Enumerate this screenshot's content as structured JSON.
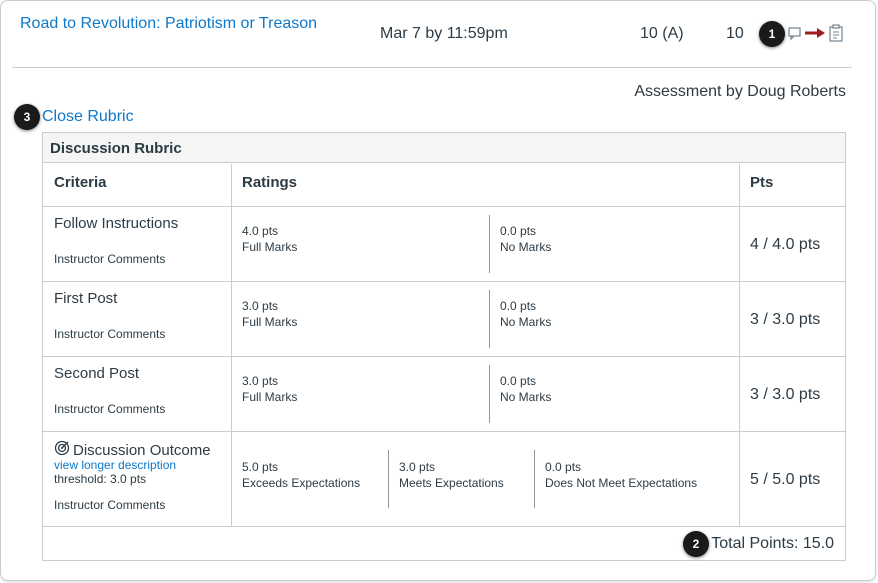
{
  "assignment": {
    "title": "Road to Revolution: Patriotism or Treason",
    "due": "Mar 7 by 11:59pm",
    "score": "10 (A)",
    "out_of": "10"
  },
  "assessor": "Assessment by Doug Roberts",
  "close_rubric": "Close Rubric",
  "callouts": [
    "1",
    "2",
    "3"
  ],
  "icons": [
    "comment-icon",
    "arrow-pointer-icon",
    "rubric-clipboard-icon"
  ],
  "rubric": {
    "title": "Discussion Rubric",
    "headers": {
      "criteria": "Criteria",
      "ratings": "Ratings",
      "pts": "Pts"
    },
    "rows": [
      {
        "name": "Follow Instructions",
        "comments": "Instructor Comments",
        "ratings": [
          {
            "pts": "4.0 pts",
            "label": "Full Marks"
          },
          {
            "pts": "0.0 pts",
            "label": "No Marks"
          }
        ],
        "score": "4 / 4.0 pts"
      },
      {
        "name": "First Post",
        "comments": "Instructor Comments",
        "ratings": [
          {
            "pts": "3.0 pts",
            "label": "Full Marks"
          },
          {
            "pts": "0.0 pts",
            "label": "No Marks"
          }
        ],
        "score": "3 / 3.0 pts"
      },
      {
        "name": "Second Post",
        "comments": "Instructor Comments",
        "ratings": [
          {
            "pts": "3.0 pts",
            "label": "Full Marks"
          },
          {
            "pts": "0.0 pts",
            "label": "No Marks"
          }
        ],
        "score": "3 / 3.0 pts"
      },
      {
        "name": "Discussion Outcome",
        "icon": "outcome-target-icon",
        "link": "view longer description",
        "threshold": "threshold: 3.0 pts",
        "comments": "Instructor Comments",
        "ratings": [
          {
            "pts": "5.0 pts",
            "label": "Exceeds Expectations"
          },
          {
            "pts": "3.0 pts",
            "label": "Meets Expectations"
          },
          {
            "pts": "0.0 pts",
            "label": "Does Not Meet Expectations"
          }
        ],
        "score": "5 / 5.0 pts"
      }
    ],
    "total": "Total Points: 15.0"
  }
}
